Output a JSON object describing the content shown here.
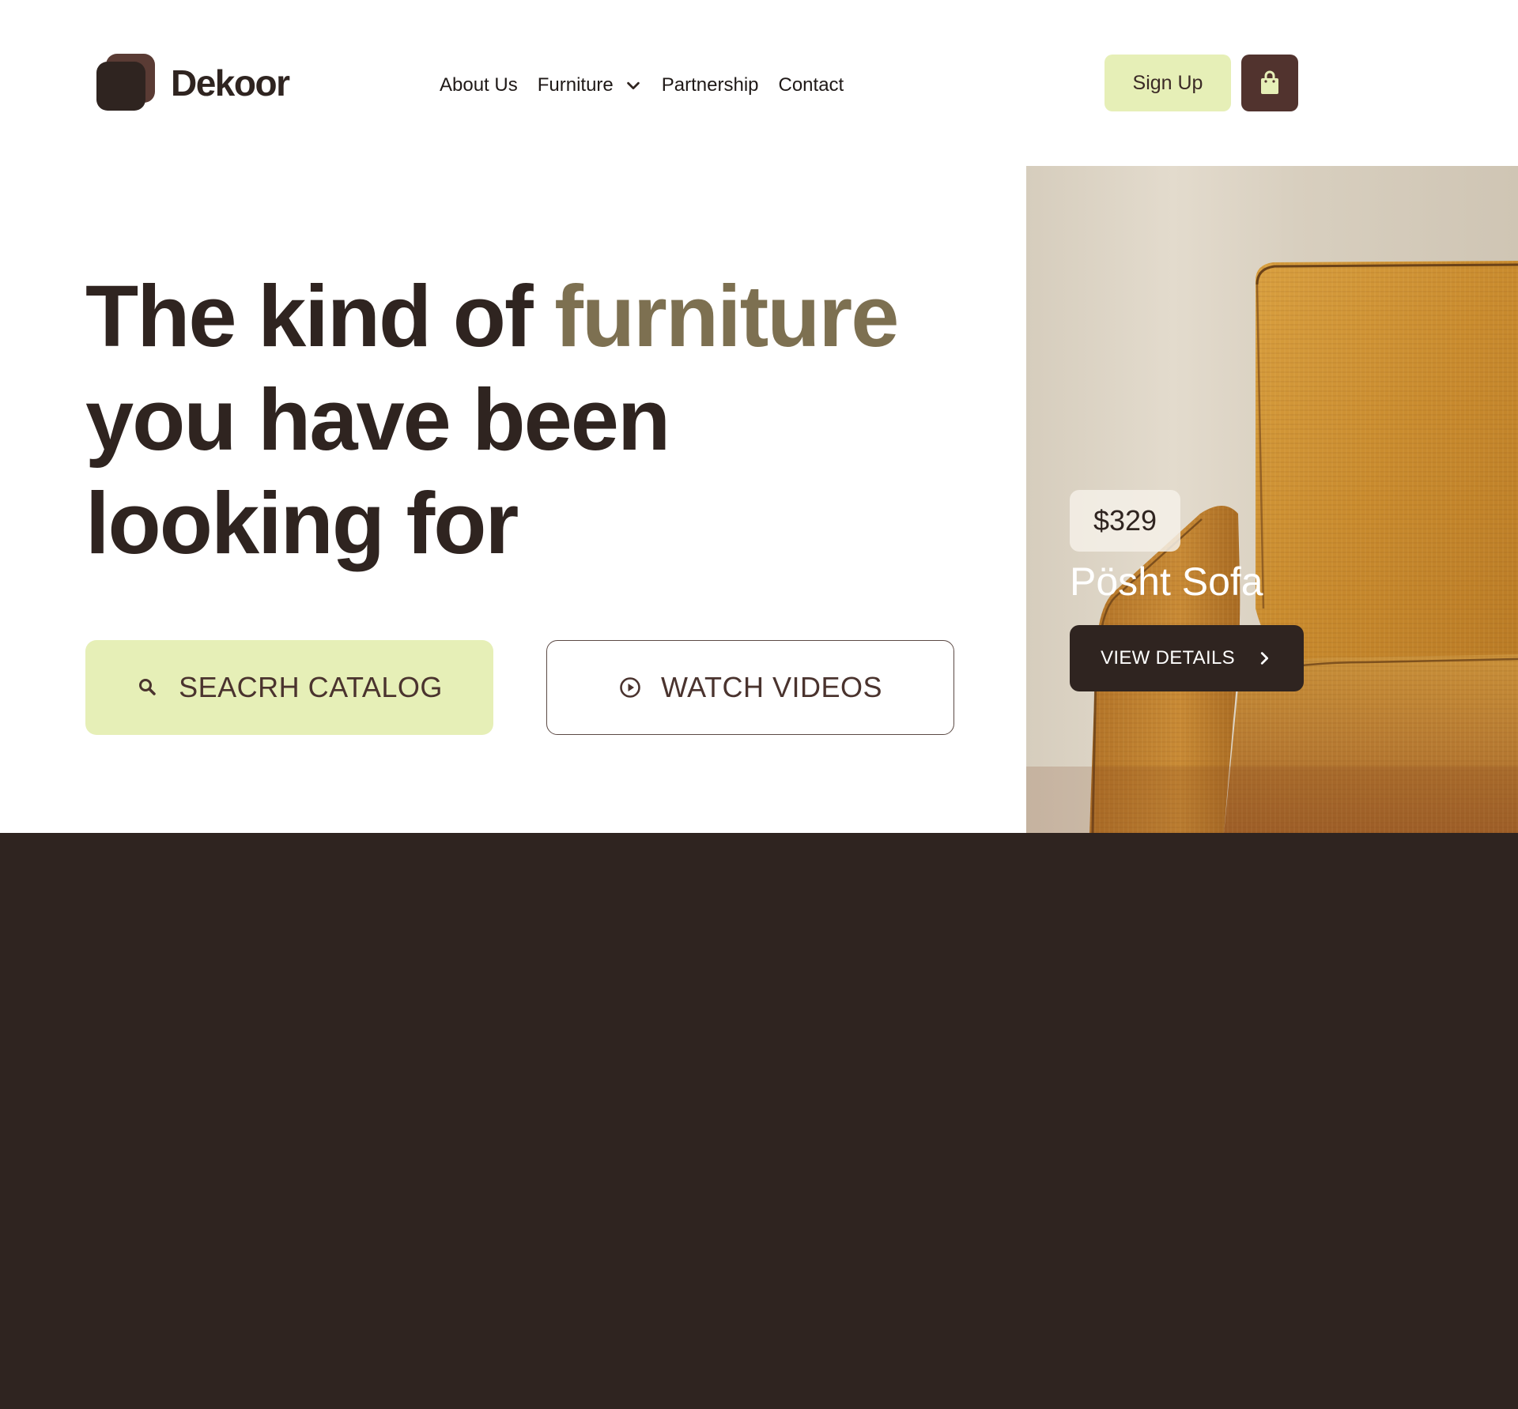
{
  "brand": {
    "name": "Dekoor",
    "colors": {
      "dark": "#2f2420",
      "brown": "#51332e",
      "accent_text": "#7d7051",
      "lime": "#e6efb7"
    }
  },
  "nav": {
    "items": [
      {
        "label": "About Us"
      },
      {
        "label": "Furniture",
        "icon": "chevron-down-icon"
      },
      {
        "label": "Partnership"
      },
      {
        "label": "Contact"
      }
    ]
  },
  "header": {
    "signup_label": "Sign Up",
    "cart_icon": "shopping-bag-icon"
  },
  "hero": {
    "title_part1": "The kind of ",
    "title_accent": "furniture",
    "title_part2": "you have been",
    "title_part3": "looking for",
    "search_cta": {
      "label": "SEACRH CATALOG",
      "icon": "search-icon"
    },
    "watch_cta": {
      "label": "WATCH VIDEOS",
      "icon": "play-circle-icon"
    }
  },
  "product": {
    "price": "$329",
    "name": "Pösht Sofa",
    "details_label": "VIEW DETAILS",
    "details_icon": "chevron-right-icon"
  }
}
